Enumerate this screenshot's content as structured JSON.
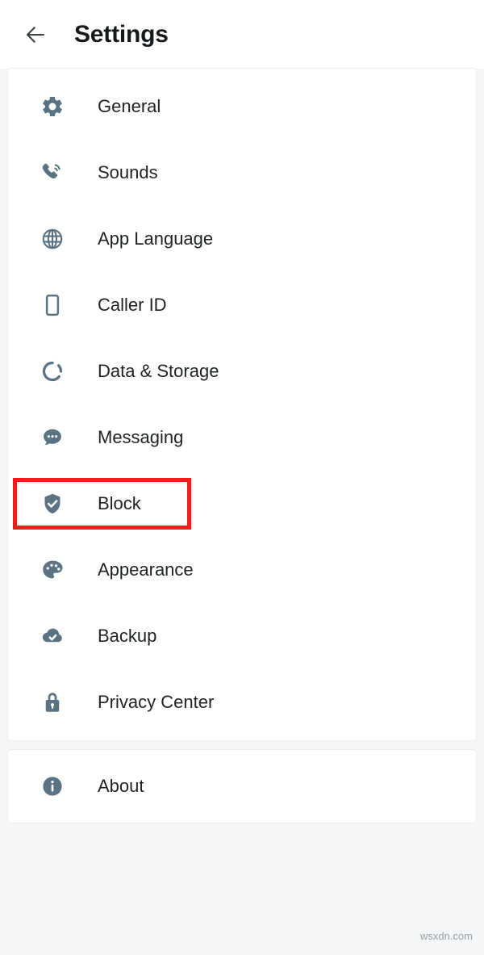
{
  "header": {
    "title": "Settings",
    "back_icon": "arrow-left-icon"
  },
  "colors": {
    "page_background": "#f4f6f8",
    "card_background": "#ffffff",
    "icon": "#5a7383",
    "label_text": "#1e2225",
    "title_text": "#15191c",
    "annotation_highlight": "#f41b1b"
  },
  "settings_groups": [
    {
      "name": "primary",
      "items": [
        {
          "label": "General",
          "icon": "gear-icon"
        },
        {
          "label": "Sounds",
          "icon": "phone-ringing-icon"
        },
        {
          "label": "App Language",
          "icon": "globe-icon"
        },
        {
          "label": "Caller ID",
          "icon": "smartphone-icon"
        },
        {
          "label": "Data & Storage",
          "icon": "donut-chart-icon"
        },
        {
          "label": "Messaging",
          "icon": "chat-bubble-icon"
        },
        {
          "label": "Block",
          "icon": "shield-check-icon",
          "highlighted": true
        },
        {
          "label": "Appearance",
          "icon": "palette-icon"
        },
        {
          "label": "Backup",
          "icon": "cloud-check-icon"
        },
        {
          "label": "Privacy Center",
          "icon": "lock-icon"
        }
      ]
    },
    {
      "name": "secondary",
      "items": [
        {
          "label": "About",
          "icon": "info-circle-icon"
        }
      ]
    }
  ],
  "annotation": {
    "target_label": "Block",
    "shape": "rectangle",
    "color": "#f41b1b"
  },
  "watermark": {
    "text": "wsxdn.com"
  }
}
